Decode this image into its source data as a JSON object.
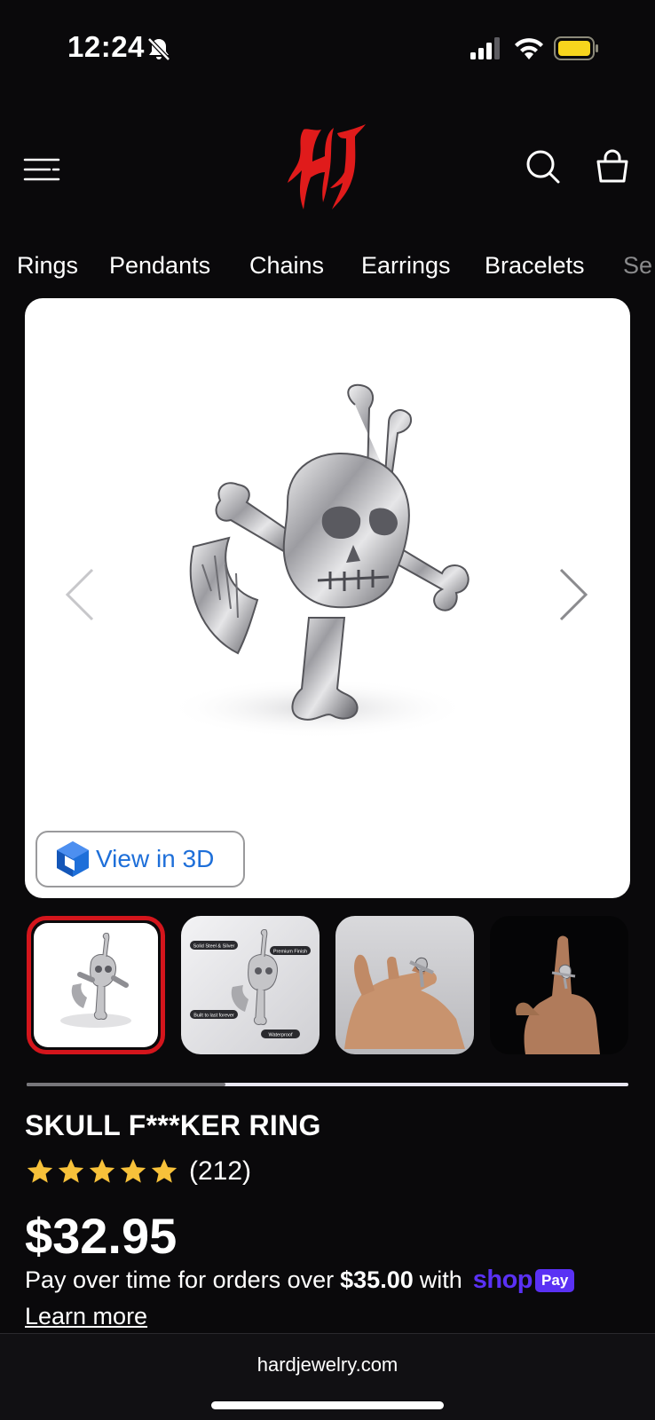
{
  "status_bar": {
    "time": "12:24",
    "icons": [
      "bell-off-icon",
      "signal-icon",
      "wifi-icon",
      "battery-icon"
    ]
  },
  "header": {
    "logo_text": "HJ",
    "icons": [
      "menu-icon",
      "search-icon",
      "cart-icon"
    ],
    "brand_color": "#e01b1b"
  },
  "categories": [
    "Rings",
    "Pendants",
    "Chains",
    "Earrings",
    "Bracelets",
    "Se"
  ],
  "gallery": {
    "view3d_label": "View in 3D",
    "thumbnail_count": 4,
    "selected_index": 0,
    "scroll_progress": 0.33,
    "thumb2_labels": [
      "Solid Steel & Silver",
      "Premium Finish",
      "Built to last forever",
      "Waterproof"
    ]
  },
  "product": {
    "title": "SKULL F***KER RING",
    "rating_stars": 5,
    "rating_count": "(212)",
    "price": "$32.95",
    "installment_prefix": "Pay over time for orders over",
    "installment_amount": "$35.00",
    "installment_suffix": "with",
    "shop_logo": "shop",
    "pay_badge": "Pay",
    "learn_more": "Learn more"
  },
  "browser": {
    "url": "hardjewelry.com"
  },
  "colors": {
    "background": "#0a090b",
    "accent_red": "#d4151c",
    "shop_purple": "#5a31f4",
    "star_yellow": "#f7c13a",
    "link_blue": "#1e6fd9"
  }
}
